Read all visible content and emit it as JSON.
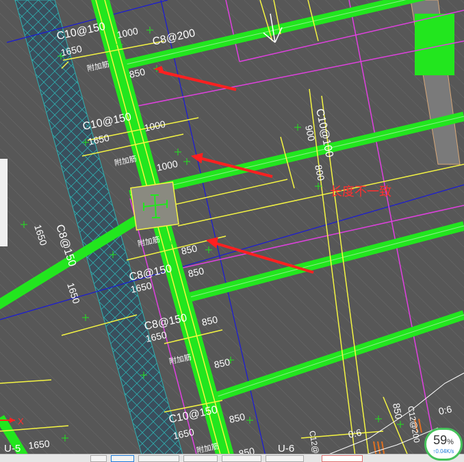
{
  "drawing": {
    "steel_labels": [
      "C10@150",
      "C8@200",
      "C10@150",
      "C10@100",
      "C8@150",
      "C8@150",
      "C8@150",
      "C10@150",
      "C12@200",
      "C12@200",
      "C12@200"
    ],
    "dimension_labels": [
      "1650",
      "1000",
      "1650",
      "850",
      "1000",
      "1650",
      "1000",
      "900",
      "800",
      "1650",
      "1650",
      "850",
      "1650",
      "850",
      "1650",
      "850",
      "850",
      "1650",
      "850",
      "1650",
      "850",
      "850",
      "1650",
      "0:6",
      "0:6"
    ],
    "tag_label": "附加筋",
    "axis_labels": [
      "U-5",
      "U-6"
    ],
    "axis_marker": "X"
  },
  "annotation": {
    "note": "长度不一致",
    "color": "#ff2a2a"
  },
  "colors": {
    "background": "#575757",
    "beam_green": "#22e61e",
    "beam_yellow": "#f5f542",
    "magenta": "#e040e0",
    "blue": "#1010c8",
    "wall_fill": "#3a4e5c"
  },
  "network_widget": {
    "percent": "59",
    "percent_sign": "%",
    "speed": "↑0.04K/s"
  }
}
